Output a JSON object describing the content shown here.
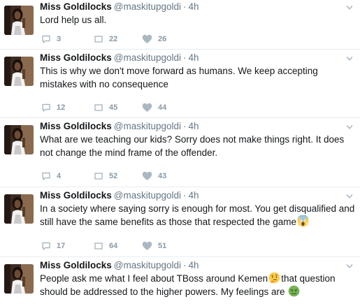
{
  "colors": {
    "text": "#14171a",
    "meta": "#657786",
    "action": "#8899a6",
    "divider": "#e6ecf0"
  },
  "icons": {
    "reply": "reply-icon",
    "retweet": "retweet-icon",
    "like": "heart-icon",
    "more": "chevron-down-icon"
  },
  "tweets": [
    {
      "name": "Miss Goldilocks",
      "handle": "@maskitupgoldi",
      "dot": "·",
      "time": "4h",
      "text": "Lord help us all.",
      "replies": "3",
      "retweets": "22",
      "likes": "26"
    },
    {
      "name": "Miss Goldilocks",
      "handle": "@maskitupgoldi",
      "dot": "·",
      "time": "4h",
      "text": "This is why we don't move forward as humans. We keep accepting mistakes with no consequence",
      "replies": "12",
      "retweets": "45",
      "likes": "44"
    },
    {
      "name": "Miss Goldilocks",
      "handle": "@maskitupgoldi",
      "dot": "·",
      "time": "4h",
      "text": "What are we teaching our kids? Sorry does not make things right. It does not change the mind frame of the offender.",
      "replies": "4",
      "retweets": "52",
      "likes": "43"
    },
    {
      "name": "Miss Goldilocks",
      "handle": "@maskitupgoldi",
      "dot": "·",
      "time": "4h",
      "text": "In a society where saying sorry is enough for most. You get disqualified and still have the same benefits as those that respected the game",
      "emoji": "face-screaming-in-fear",
      "replies": "17",
      "retweets": "64",
      "likes": "51"
    },
    {
      "name": "Miss Goldilocks",
      "handle": "@maskitupgoldi",
      "dot": "·",
      "time": "4h",
      "text_a": "People ask me what I feel about TBoss around Kemen",
      "emoji_a": "thinking-face",
      "text_b": "that question should be addressed to the higher powers. My feelings are ",
      "emoji_b": "nauseated-face"
    }
  ]
}
